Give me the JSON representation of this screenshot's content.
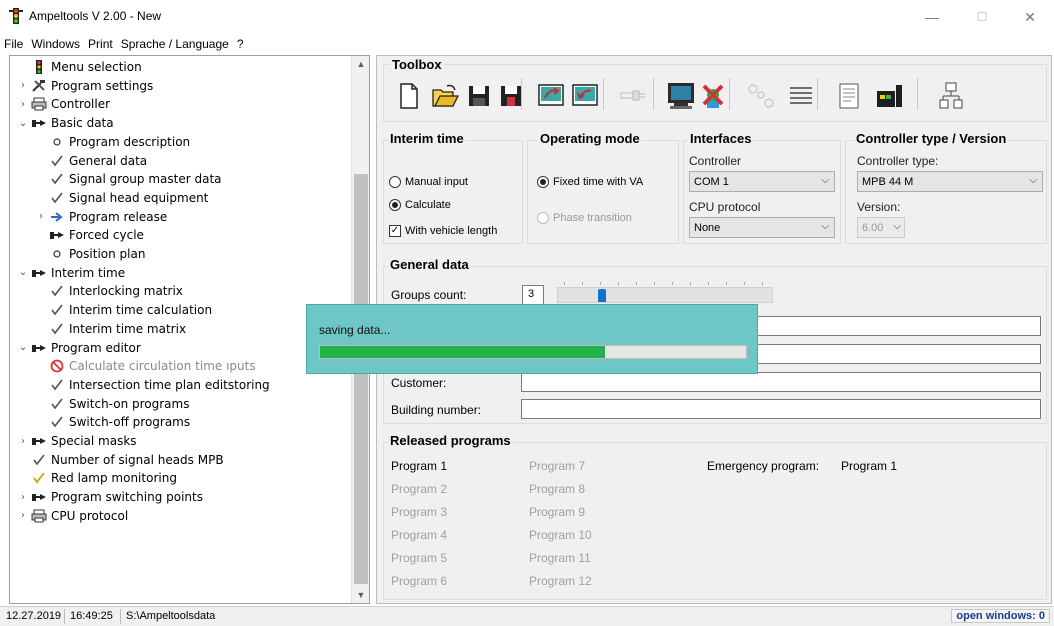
{
  "window": {
    "title": "Ampeltools V 2.00 - New",
    "minimize": "—",
    "maximize": "☐",
    "close": "✕"
  },
  "menu": [
    "File",
    "Windows",
    "Print",
    "Sprache / Language",
    "?"
  ],
  "tree": [
    {
      "label": "Menu selection",
      "icon": "traffic-light-icon",
      "expander": "",
      "level": 0
    },
    {
      "label": "Program settings",
      "icon": "tools-icon",
      "expander": ">",
      "level": 0
    },
    {
      "label": "Controller",
      "icon": "printer-icon",
      "expander": ">",
      "level": 0
    },
    {
      "label": "Basic data",
      "icon": "pointing-hand-icon",
      "expander": "v",
      "level": 0
    },
    {
      "label": "Program description",
      "icon": "circle-icon",
      "expander": "",
      "level": 1
    },
    {
      "label": "General data",
      "icon": "checkmark-icon",
      "expander": "",
      "level": 1
    },
    {
      "label": "Signal group master data",
      "icon": "checkmark-icon",
      "expander": "",
      "level": 1
    },
    {
      "label": "Signal head equipment",
      "icon": "checkmark-icon",
      "expander": "",
      "level": 1
    },
    {
      "label": "Program release",
      "icon": "arrow-right-icon",
      "expander": ">",
      "level": 1
    },
    {
      "label": "Forced cycle",
      "icon": "pointing-hand-icon",
      "expander": "",
      "level": 1
    },
    {
      "label": "Position plan",
      "icon": "circle-icon",
      "expander": "",
      "level": 1
    },
    {
      "label": "Interim time",
      "icon": "pointing-hand-icon",
      "expander": "v",
      "level": 0
    },
    {
      "label": "Interlocking matrix",
      "icon": "checkmark-icon",
      "expander": "",
      "level": 1
    },
    {
      "label": "Interim time calculation",
      "icon": "checkmark-icon",
      "expander": "",
      "level": 1
    },
    {
      "label": "Interim time matrix",
      "icon": "checkmark-icon",
      "expander": "",
      "level": 1
    },
    {
      "label": "Program editor",
      "icon": "pointing-hand-icon",
      "expander": "v",
      "level": 0
    },
    {
      "label": "Calculate circulation time ıputs",
      "icon": "prohibited-icon",
      "expander": "",
      "level": 1,
      "disabled": true
    },
    {
      "label": "Intersection time plan editstoring",
      "icon": "checkmark-icon",
      "expander": "",
      "level": 1
    },
    {
      "label": "Switch-on programs",
      "icon": "checkmark-icon",
      "expander": "",
      "level": 1
    },
    {
      "label": "Switch-off programs",
      "icon": "checkmark-icon",
      "expander": "",
      "level": 1
    },
    {
      "label": "Special masks",
      "icon": "pointing-hand-icon",
      "expander": ">",
      "level": 0
    },
    {
      "label": "Number of signal heads MPB",
      "icon": "checkmark-icon",
      "expander": "",
      "level": 0
    },
    {
      "label": "Red lamp monitoring",
      "icon": "checkmark-yellow-icon",
      "expander": "",
      "level": 0
    },
    {
      "label": "Program switching points",
      "icon": "pointing-hand-icon",
      "expander": ">",
      "level": 0
    },
    {
      "label": "CPU protocol",
      "icon": "printer-icon",
      "expander": ">",
      "level": 0
    }
  ],
  "toolbox": {
    "title": "Toolbox",
    "icons": [
      "new-document-icon",
      "open-folder-icon",
      "save-icon",
      "save-as-icon",
      "upload-icon",
      "download-icon",
      "connector-icon",
      "monitor-icon",
      "cancel-x-icon",
      "nodes-icon",
      "list-icon",
      "report-icon",
      "controller-device-icon",
      "network-icon"
    ]
  },
  "interim_time": {
    "title": "Interim time",
    "manual": "Manual input",
    "calculate": "Calculate",
    "vehicle_length": "With vehicle length",
    "selected": "calculate",
    "vehicle_length_checked": true
  },
  "operating_mode": {
    "title": "Operating mode",
    "fixed": "Fixed time with VA",
    "phase": "Phase transition",
    "selected": "fixed"
  },
  "interfaces": {
    "title": "Interfaces",
    "controller_label": "Controller",
    "controller_value": "COM 1",
    "cpu_label": "CPU protocol",
    "cpu_value": "None"
  },
  "controller_type": {
    "title": "Controller type / Version",
    "type_label": "Controller type:",
    "type_value": "MPB 44 M",
    "version_label": "Version:",
    "version_value": "6.00"
  },
  "general_data": {
    "title": "General data",
    "groups_label": "Groups count:",
    "groups_value": "3",
    "slider_fraction": 0.2,
    "customer_label": "Customer:",
    "building_label": "Building number:"
  },
  "released": {
    "title": "Released programs",
    "col1": [
      {
        "label": "Program 1",
        "enabled": true
      },
      {
        "label": "Program 2",
        "enabled": false
      },
      {
        "label": "Program 3",
        "enabled": false
      },
      {
        "label": "Program 4",
        "enabled": false
      },
      {
        "label": "Program 5",
        "enabled": false
      },
      {
        "label": "Program 6",
        "enabled": false
      }
    ],
    "col2": [
      "Program 7",
      "Program 8",
      "Program 9",
      "Program 10",
      "Program 11",
      "Program 12"
    ],
    "emergency_label": "Emergency program:",
    "emergency_value": "Program 1"
  },
  "saving": {
    "text": "saving data...",
    "progress": 0.67
  },
  "status": {
    "date": "12.27.2019",
    "time": "16:49:25",
    "path": "S:\\Ampeltoolsdata",
    "open_windows": "open windows: 0"
  },
  "colors": {
    "progress_fill": "#22b04a",
    "overlay_bg": "#6fc6c7",
    "open_windows_text": "#1a3b8f"
  }
}
